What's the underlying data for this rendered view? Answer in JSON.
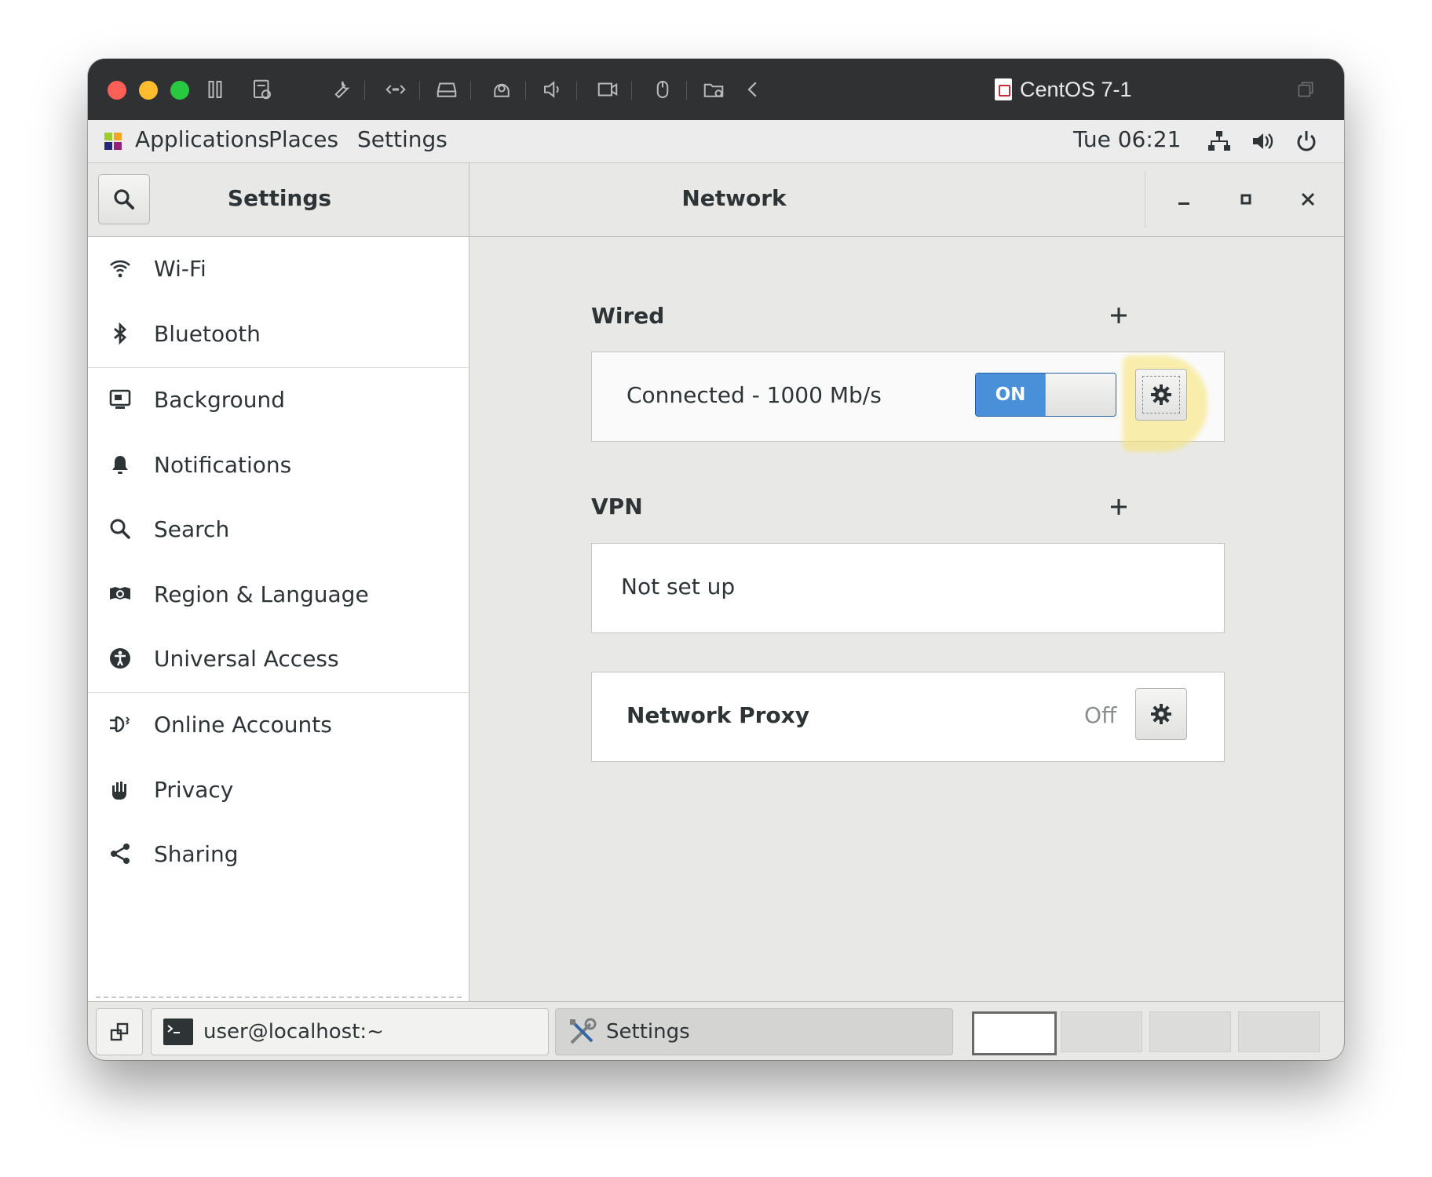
{
  "vm": {
    "title": "CentOS 7-1",
    "toolbar_icons": [
      "pause-icon",
      "snapshot-icon",
      "wrench-icon",
      "code-arrows-icon",
      "hard-drive-icon",
      "webcam-icon",
      "speaker-icon",
      "camera-icon",
      "mouse-icon",
      "shared-folder-icon",
      "chevron-left-icon"
    ]
  },
  "topbar": {
    "applications": "Applications",
    "places": "Places",
    "settings": "Settings",
    "clock": "Tue 06:21"
  },
  "header": {
    "left_title": "Settings",
    "right_title": "Network"
  },
  "sidebar": {
    "items": [
      {
        "label": "Wi-Fi",
        "icon": "wifi-icon"
      },
      {
        "label": "Bluetooth",
        "icon": "bluetooth-icon"
      },
      {
        "label": "Background",
        "icon": "background-icon"
      },
      {
        "label": "Notifications",
        "icon": "bell-icon"
      },
      {
        "label": "Search",
        "icon": "search-icon"
      },
      {
        "label": "Region & Language",
        "icon": "region-icon"
      },
      {
        "label": "Universal Access",
        "icon": "accessibility-icon"
      },
      {
        "label": "Online Accounts",
        "icon": "online-accounts-icon"
      },
      {
        "label": "Privacy",
        "icon": "hand-icon"
      },
      {
        "label": "Sharing",
        "icon": "share-icon"
      }
    ]
  },
  "network": {
    "wired": {
      "title": "Wired",
      "status": "Connected - 1000 Mb/s",
      "toggle_label": "ON"
    },
    "vpn": {
      "title": "VPN",
      "status": "Not set up"
    },
    "proxy": {
      "title": "Network Proxy",
      "status": "Off"
    }
  },
  "taskbar": {
    "terminal": "user@localhost:~",
    "settings": "Settings"
  },
  "colors": {
    "accent": "#4a90d9",
    "highlight": "#f7e36b"
  }
}
